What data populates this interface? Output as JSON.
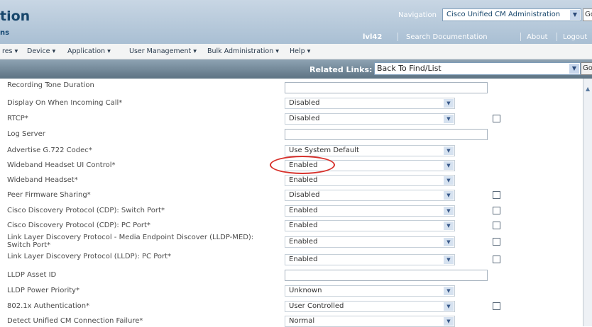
{
  "header": {
    "title": "tion",
    "subtitle": "ns",
    "navigation_label": "Navigation",
    "navigation_value": "Cisco Unified CM Administration",
    "go_label": "Go",
    "user": "lvl42",
    "links": {
      "search": "Search Documentation",
      "about": "About",
      "logout": "Logout"
    }
  },
  "menu": {
    "items": [
      "res ▾",
      "Device ▾",
      "Application ▾",
      "User Management ▾",
      "Bulk Administration ▾",
      "Help ▾"
    ]
  },
  "related_links": {
    "label": "Related Links:",
    "value": "Back To Find/List",
    "go_label": "Go"
  },
  "rows": [
    {
      "label": "Recording Tone Duration",
      "type": "text",
      "value": ""
    },
    {
      "label": "Display On When Incoming Call*",
      "type": "select",
      "value": "Disabled",
      "checkbox": false
    },
    {
      "label": "RTCP*",
      "type": "select",
      "value": "Disabled",
      "checkbox": true
    },
    {
      "label": "Log Server",
      "type": "text",
      "value": ""
    },
    {
      "label": "Advertise G.722 Codec*",
      "type": "select",
      "value": "Use System Default",
      "checkbox": false
    },
    {
      "label": "Wideband Headset UI Control*",
      "type": "select",
      "value": "Enabled",
      "checkbox": false
    },
    {
      "label": "Wideband Headset*",
      "type": "select",
      "value": "Enabled",
      "checkbox": false
    },
    {
      "label": "Peer Firmware Sharing*",
      "type": "select",
      "value": "Disabled",
      "checkbox": true
    },
    {
      "label": "Cisco Discovery Protocol (CDP): Switch Port*",
      "type": "select",
      "value": "Enabled",
      "checkbox": true
    },
    {
      "label": "Cisco Discovery Protocol (CDP): PC Port*",
      "type": "select",
      "value": "Enabled",
      "checkbox": true
    },
    {
      "label": "Link Layer Discovery Protocol - Media Endpoint Discover (LLDP-MED): Switch Port*",
      "type": "select",
      "value": "Enabled",
      "checkbox": true
    },
    {
      "label": "Link Layer Discovery Protocol (LLDP): PC Port*",
      "type": "select",
      "value": "Enabled",
      "checkbox": true
    },
    {
      "label": "LLDP Asset ID",
      "type": "text",
      "value": ""
    },
    {
      "label": "LLDP Power Priority*",
      "type": "select",
      "value": "Unknown",
      "checkbox": false
    },
    {
      "label": "802.1x Authentication*",
      "type": "select",
      "value": "User Controlled",
      "checkbox": true
    },
    {
      "label": "Detect Unified CM Connection Failure*",
      "type": "select",
      "value": "Normal",
      "checkbox": false
    }
  ],
  "colors": {
    "highlight_oval": "#d8322c",
    "header": "#a9bfd3",
    "related_bar": "#5d7383"
  }
}
